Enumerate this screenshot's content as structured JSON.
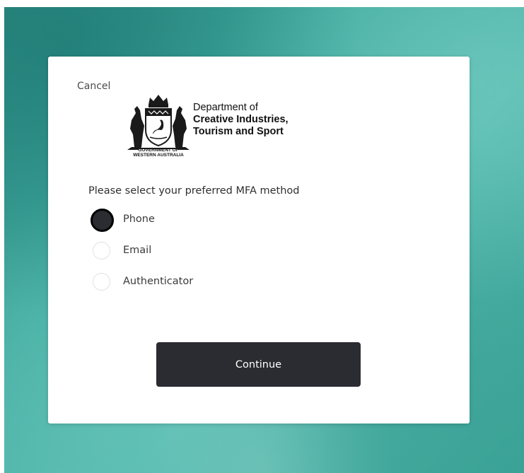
{
  "colors": {
    "background_teal": "#43aca1",
    "card": "#ffffff",
    "button": "#2b2c31",
    "button_text": "#ffffff",
    "radio_selected": "#2b2c31"
  },
  "form": {
    "cancel_label": "Cancel",
    "logo": {
      "crest_caption_line1": "GOVERNMENT OF",
      "crest_caption_line2": "WESTERN AUSTRALIA",
      "dept_line1": "Department of",
      "dept_line2": "Creative Industries,",
      "dept_line3": "Tourism and Sport"
    },
    "prompt": "Please select your preferred MFA method",
    "options": [
      {
        "label": "Phone",
        "selected": true
      },
      {
        "label": "Email",
        "selected": false
      },
      {
        "label": "Authenticator",
        "selected": false
      }
    ],
    "continue_label": "Continue"
  }
}
